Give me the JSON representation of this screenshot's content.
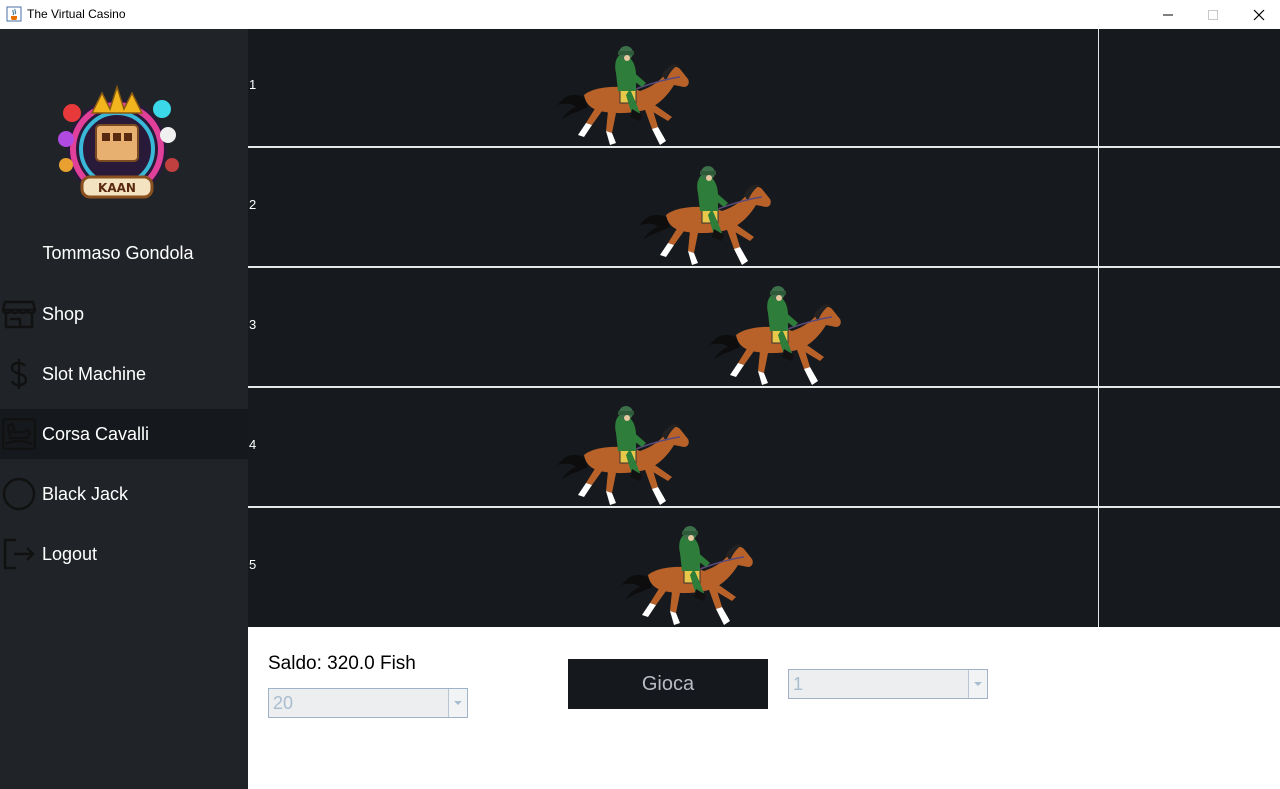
{
  "window": {
    "title": "The Virtual Casino"
  },
  "sidebar": {
    "user_name": "Tommaso Gondola",
    "items": [
      {
        "label": "Shop",
        "icon": "store-icon"
      },
      {
        "label": "Slot Machine",
        "icon": "dollar-icon"
      },
      {
        "label": "Corsa Cavalli",
        "icon": "rocking-horse-icon",
        "active": true
      },
      {
        "label": "Black Jack",
        "icon": "circle-icon"
      },
      {
        "label": "Logout",
        "icon": "logout-icon"
      }
    ]
  },
  "race": {
    "lanes": [
      {
        "number": "1"
      },
      {
        "number": "2"
      },
      {
        "number": "3"
      },
      {
        "number": "4"
      },
      {
        "number": "5"
      }
    ]
  },
  "controls": {
    "balance_text": "Saldo: 320.0 Fish",
    "bet_amount": "20",
    "play_label": "Gioca",
    "horse_choice": "1"
  },
  "colors": {
    "sidebar_bg": "#202428",
    "sidebar_active_bg": "#15181c",
    "track_bg": "#16191d",
    "lane_line": "#e6e6e6",
    "button_bg": "#15181c"
  }
}
